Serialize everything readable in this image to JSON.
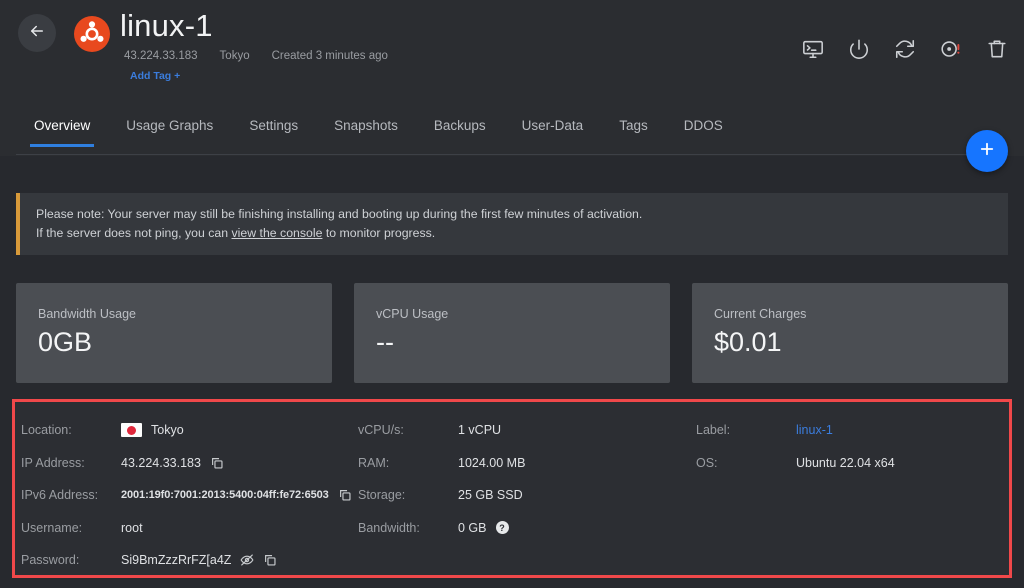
{
  "header": {
    "back_icon": "arrow-left-icon",
    "os_logo": "ubuntu-logo",
    "title": "linux-1",
    "ip": "43.224.33.183",
    "region": "Tokyo",
    "created": "Created 3 minutes ago",
    "add_tag": "Add Tag +",
    "actions": [
      {
        "name": "console-icon",
        "label": "Console"
      },
      {
        "name": "power-icon",
        "label": "Power"
      },
      {
        "name": "restart-icon",
        "label": "Restart"
      },
      {
        "name": "iso-warning-icon",
        "label": "ISO"
      },
      {
        "name": "trash-icon",
        "label": "Destroy"
      }
    ]
  },
  "tabs": [
    {
      "label": "Overview",
      "active": true
    },
    {
      "label": "Usage Graphs",
      "active": false
    },
    {
      "label": "Settings",
      "active": false
    },
    {
      "label": "Snapshots",
      "active": false
    },
    {
      "label": "Backups",
      "active": false
    },
    {
      "label": "User-Data",
      "active": false
    },
    {
      "label": "Tags",
      "active": false
    },
    {
      "label": "DDOS",
      "active": false
    }
  ],
  "fab": {
    "icon": "plus-icon",
    "label": "+"
  },
  "notice": {
    "line1": "Please note: Your server may still be finishing installing and booting up during the first few minutes of activation.",
    "line2_pre": "If the server does not ping, you can ",
    "line2_link": "view the console",
    "line2_post": " to monitor progress.",
    "accent_color": "#d89a3a"
  },
  "cards": [
    {
      "label": "Bandwidth Usage",
      "value": "0GB"
    },
    {
      "label": "vCPU Usage",
      "value": "--"
    },
    {
      "label": "Current Charges",
      "value": "$0.01"
    }
  ],
  "details": {
    "col1": [
      {
        "key": "Location:",
        "value": "Tokyo"
      },
      {
        "key": "IP Address:",
        "value": "43.224.33.183"
      },
      {
        "key": "IPv6 Address:",
        "value": "2001:19f0:7001:2013:5400:04ff:fe72:6503"
      },
      {
        "key": "Username:",
        "value": "root"
      },
      {
        "key": "Password:",
        "value": "Si9BmZzzRrFZ[a4Z"
      }
    ],
    "col2": [
      {
        "key": "vCPU/s:",
        "value": "1 vCPU"
      },
      {
        "key": "RAM:",
        "value": "1024.00 MB"
      },
      {
        "key": "Storage:",
        "value": "25 GB SSD"
      },
      {
        "key": "Bandwidth:",
        "value": "0 GB"
      }
    ],
    "col3": [
      {
        "key": "Label:",
        "value": "linux-1"
      },
      {
        "key": "OS:",
        "value": "Ubuntu 22.04 x64"
      }
    ],
    "help_glyph": "?",
    "highlight_color": "#f0484a"
  },
  "colors": {
    "page_bg": "#27292e",
    "header_bg": "#2b2d31",
    "card_bg": "#4b4e53",
    "accent_blue": "#3b7ddd",
    "fab_blue": "#1675ff"
  }
}
